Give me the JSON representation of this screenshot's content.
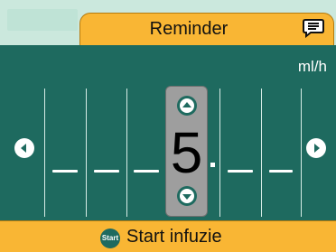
{
  "header": {
    "title": "Reminder",
    "message_icon": "message-icon"
  },
  "entry": {
    "unit": "ml/h",
    "slots_before_decimal": [
      "",
      "",
      "",
      "5"
    ],
    "slots_after_decimal": [
      "",
      ""
    ],
    "active_digit": "5",
    "prev_icon": "chevron-left-icon",
    "next_icon": "chevron-right-icon",
    "increment_icon": "chevron-up-icon",
    "decrement_icon": "chevron-down-icon"
  },
  "footer": {
    "start_badge": "Start",
    "start_label": "Start infuzie"
  },
  "colors": {
    "background": "#1e6a5f",
    "accent": "#f9b634",
    "top_strip": "#cbe8dd",
    "digit_box": "#9e9e9e"
  }
}
